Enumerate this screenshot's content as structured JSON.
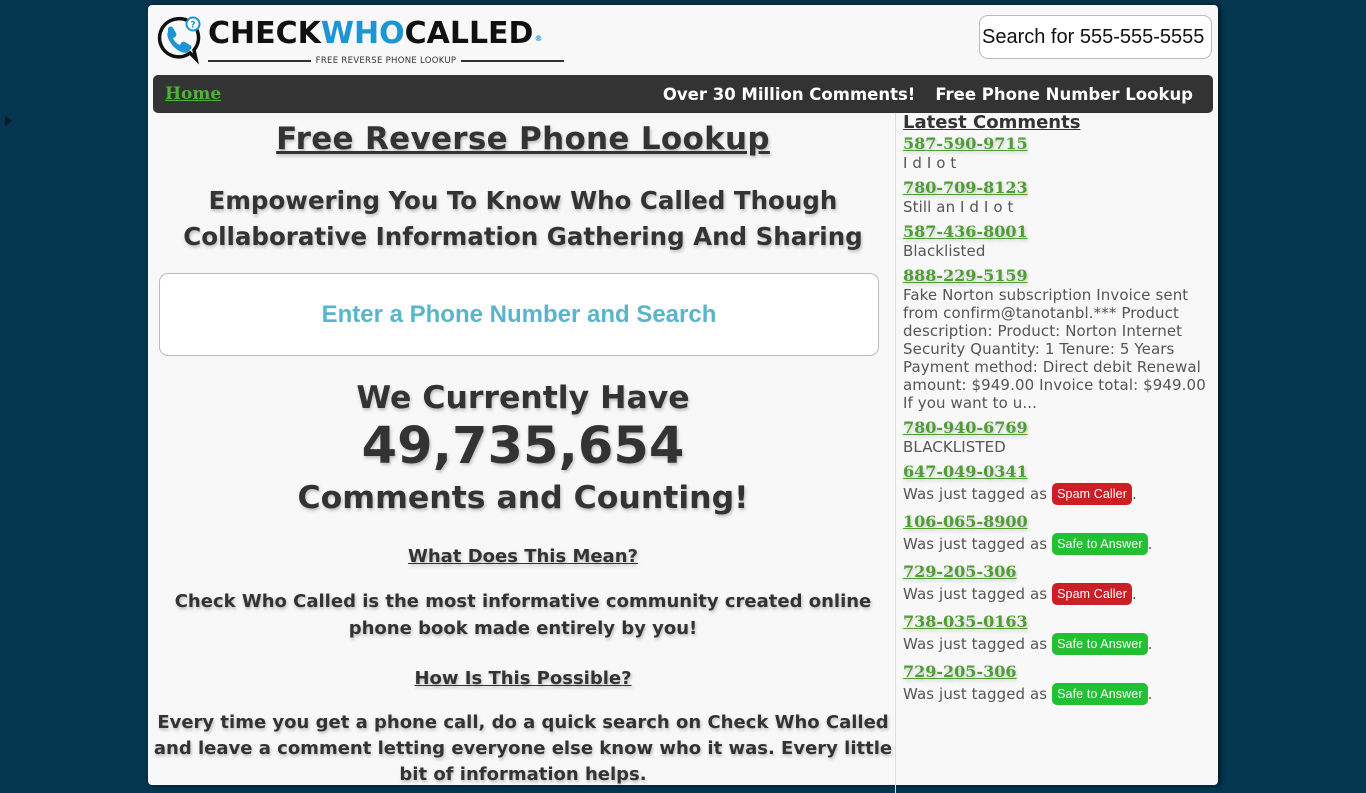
{
  "logo": {
    "word_left": "CHECK",
    "word_mid": "WHO",
    "word_right": "CALLED",
    "registered": "®",
    "tagline": "FREE REVERSE PHONE LOOKUP"
  },
  "header": {
    "search_placeholder": "Search for 555-555-5555"
  },
  "nav": {
    "home": "Home",
    "links": [
      "Over 30 Million Comments!",
      "Free Phone Number Lookup"
    ]
  },
  "main": {
    "title": "Free Reverse Phone Lookup",
    "tagline": "Empowering You To Know Who Called Though Collaborative Information Gathering And Sharing",
    "cta": "Enter a Phone Number and Search",
    "count_prefix": "We Currently Have",
    "count_value": "49,735,654",
    "count_suffix": "Comments and Counting!",
    "q1": "What Does This Mean?",
    "a1": "Check Who Called is the most informative community created online phone book made entirely by you!",
    "q2": "How Is This Possible?",
    "a2": "Every time you get a phone call, do a quick search on Check Who Called and leave a comment letting everyone else know who it was. Every little bit of information helps."
  },
  "sidebar": {
    "title": "Latest Comments",
    "tag_prefix": "Was just tagged as",
    "comments": [
      {
        "phone": "587-590-9715",
        "text": "I d I o t"
      },
      {
        "phone": "780-709-8123",
        "text": "Still an I d I o t"
      },
      {
        "phone": "587-436-8001",
        "text": "Blacklisted"
      },
      {
        "phone": "888-229-5159",
        "text": "Fake Norton subscription Invoice sent from confirm@tanotanbl.*** Product description: Product: Norton Internet Security Quantity: 1 Tenure: 5 Years Payment method: Direct debit Renewal amount: $949.00 Invoice total: $949.00 If you want to u..."
      },
      {
        "phone": "780-940-6769",
        "text": "BLACKLISTED"
      },
      {
        "phone": "647-049-0341",
        "tag": "Spam Caller",
        "tag_type": "spam"
      },
      {
        "phone": "106-065-8900",
        "tag": "Safe to Answer",
        "tag_type": "safe"
      },
      {
        "phone": "729-205-306",
        "tag": "Spam Caller",
        "tag_type": "spam"
      },
      {
        "phone": "738-035-0163",
        "tag": "Safe to Answer",
        "tag_type": "safe"
      },
      {
        "phone": "729-205-306",
        "tag": "Safe to Answer",
        "tag_type": "safe"
      }
    ]
  },
  "colors": {
    "background": "#04364f",
    "brand_blue": "#1d95d3",
    "link_green": "#4f9e34",
    "nav_bg": "#333333",
    "spam_red": "#cc1f25",
    "safe_green": "#22c032",
    "cta_text": "#5ab4cc"
  }
}
